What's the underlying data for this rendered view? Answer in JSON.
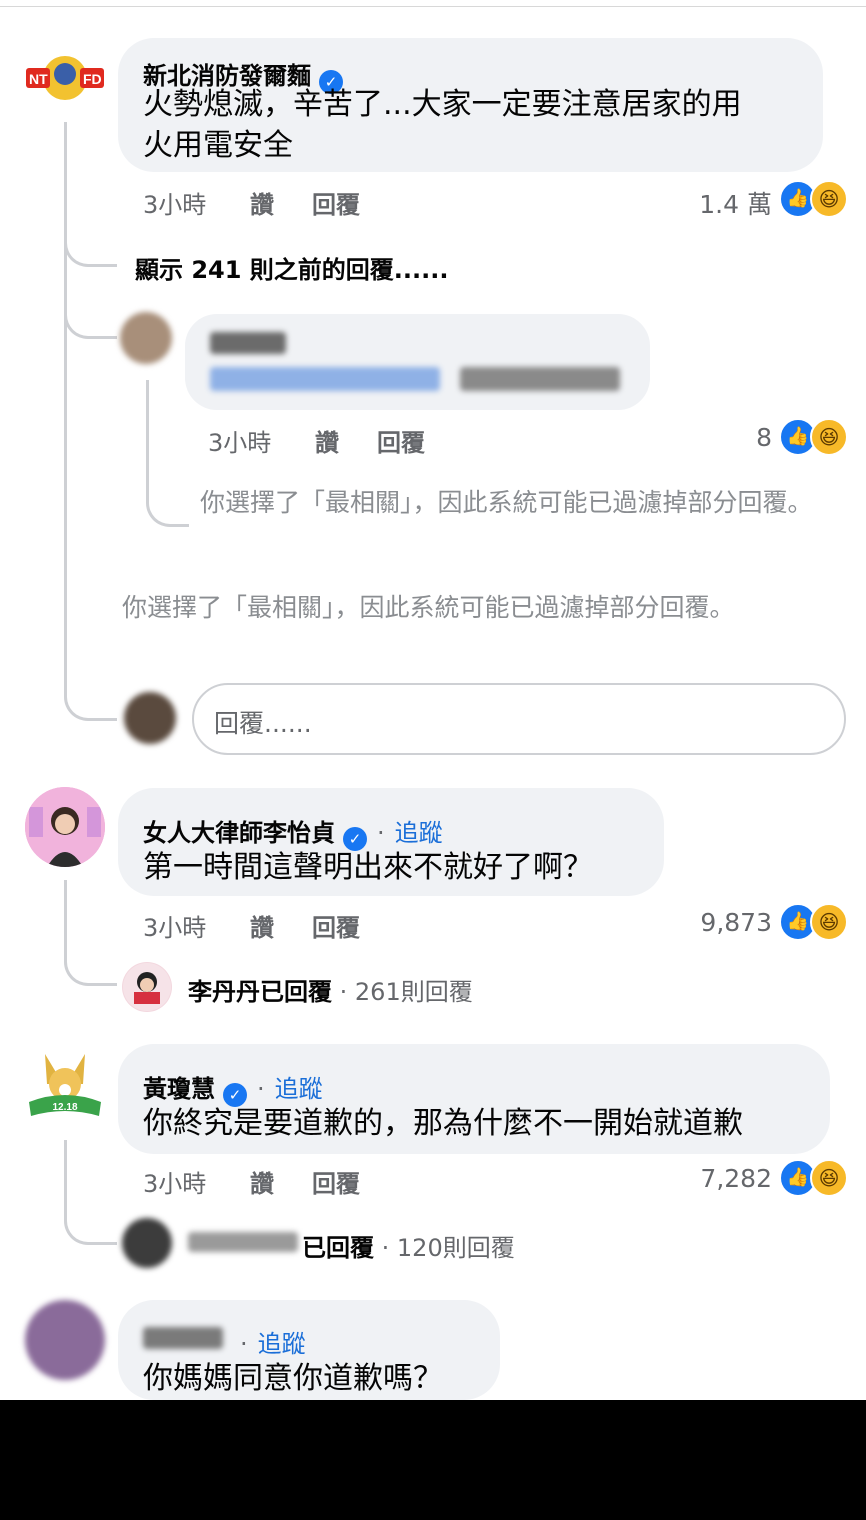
{
  "comments": [
    {
      "name": "新北消防發爾麵",
      "verified": true,
      "text_line1": "火勢熄滅，辛苦了...大家一定要注意居家的用",
      "text_line2": "火用電安全",
      "time": "3小時",
      "like": "讚",
      "reply": "回覆",
      "reactions": "1.4 萬",
      "avatar_text": "NT FD"
    },
    {
      "name": "女人大律師李怡貞",
      "verified": true,
      "follow": "追蹤",
      "text_line1": "第一時間這聲明出來不就好了啊？",
      "time": "3小時",
      "like": "讚",
      "reply": "回覆",
      "reactions": "9,873"
    },
    {
      "name": "黃瓊慧",
      "verified": true,
      "follow": "追蹤",
      "text_line1": "你終究是要道歉的，那為什麼不一開始就道歉",
      "time": "3小時",
      "like": "讚",
      "reply": "回覆",
      "reactions": "7,282",
      "avatar_text": "12.18 公投 四個不同意"
    },
    {
      "name": "",
      "follow": "追蹤",
      "text_line1": "你媽媽同意你道歉嗎？"
    }
  ],
  "thread1": {
    "show_more": "顯示 241 則之前的回覆......",
    "nested_reply": {
      "time": "3小時",
      "like": "讚",
      "reply": "回覆",
      "reactions": "8"
    },
    "filter_note_nested": "你選擇了「最相關」，因此系統可能已過濾掉部分回覆。",
    "filter_note": "你選擇了「最相關」，因此系統可能已過濾掉部分回覆。",
    "reply_placeholder": "回覆......"
  },
  "replied_summaries": [
    {
      "name": "李丹丹",
      "suffix": "已回覆",
      "count": "· 261則回覆"
    },
    {
      "name": "",
      "suffix": "已回覆",
      "count": "· 120則回覆"
    }
  ],
  "icons": {
    "verified": "verified-badge-icon",
    "like": "like-reaction-icon",
    "haha": "haha-reaction-icon"
  },
  "colors": {
    "bubble": "#f0f2f5",
    "link": "#1a6ed8",
    "meta": "#65676b",
    "verified": "#1877f2"
  }
}
